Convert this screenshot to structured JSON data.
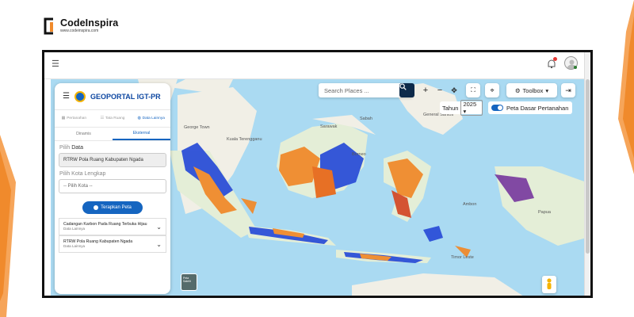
{
  "brand": {
    "name": "CodeInspira",
    "url": "www.codeinspira.com"
  },
  "colors": {
    "accent": "#f28a30",
    "primary": "#1565c0",
    "map_water": "#aadaf2",
    "map_land": "#f1efe6"
  },
  "panel": {
    "title": "GEOPORTAL IGT-PR",
    "tabs": [
      "Pertanahan",
      "Tata Ruang",
      "Data Lainnya"
    ],
    "subtabs": [
      "Dinamis",
      "Eksternal"
    ],
    "pilih_data_prefix": "Pilih",
    "pilih_data_word": "Data",
    "data_value": "RTRW Pola Ruang Kabupaten Ngada",
    "kota_label": "Pilih Kota Lengkap",
    "kota_placeholder": "-- Pilih Kota --",
    "apply_button": "Terapkan Peta",
    "layers": [
      {
        "title": "Cadangan Karbon Pada Ruang Terbuka Hijau",
        "subtitle": "Data Lainnya"
      },
      {
        "title": "RTRW Pola Ruang Kabupaten Ngada",
        "subtitle": "Data Lainnya"
      }
    ]
  },
  "search": {
    "placeholder": "Search Places ..."
  },
  "toolbar": {
    "toolbox_label": "Toolbox",
    "year_label": "Tahun",
    "year_value": "2025",
    "basemap_label": "Peta Dasar Pertanahan"
  },
  "map_labels": {
    "georgetown": "George Town",
    "kuala": "Kuala Terengganu",
    "sabah": "Sabah",
    "sarawak": "Sarawak",
    "general_santos": "General Santos",
    "borneo": "Borneo",
    "ambon": "Ambon",
    "timor": "Timor Leste",
    "papua": "Papua",
    "switch": "Peta Satelit"
  }
}
